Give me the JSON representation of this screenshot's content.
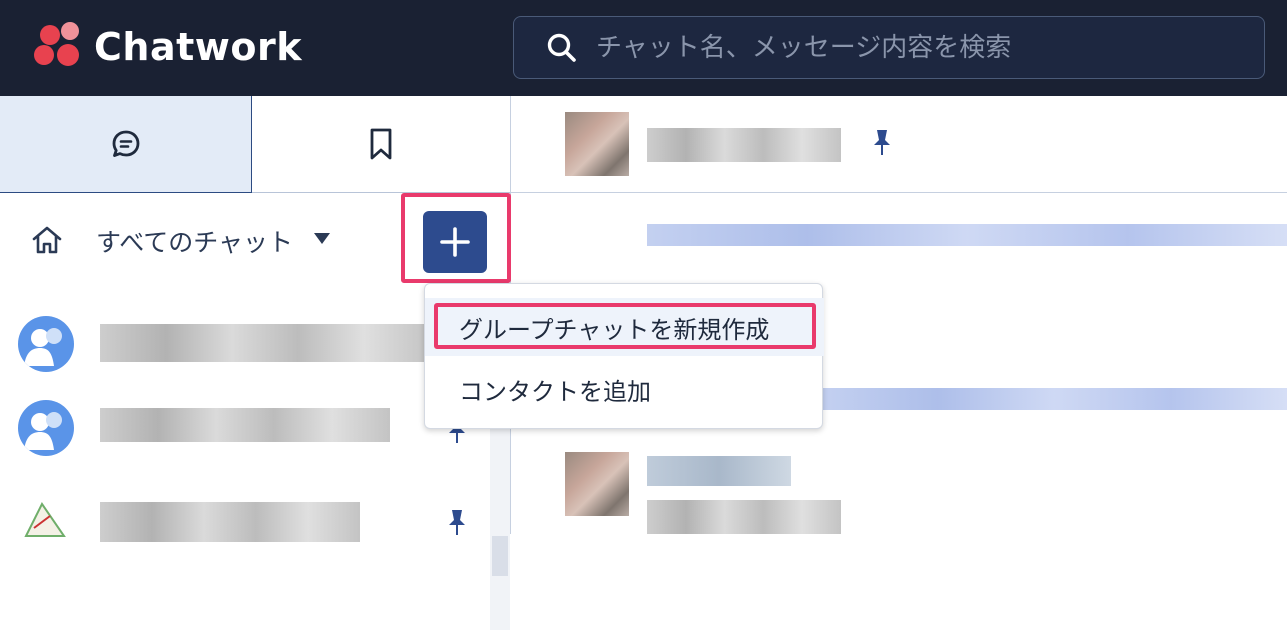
{
  "app": {
    "name": "Chatwork"
  },
  "search": {
    "placeholder": "チャット名、メッセージ内容を検索"
  },
  "sidebar": {
    "tabs": [
      {
        "name": "chat",
        "icon": "chat-bubble-icon",
        "active": true
      },
      {
        "name": "bookmark",
        "icon": "bookmark-icon",
        "active": false
      }
    ],
    "filter_label": "すべてのチャット"
  },
  "add_menu": {
    "items": [
      {
        "label": "グループチャットを新規作成",
        "highlighted": true
      },
      {
        "label": "コンタクトを追加",
        "highlighted": false
      }
    ]
  },
  "colors": {
    "header_bg": "#1a2133",
    "accent": "#2d4b8e",
    "highlight": "#e93a6c",
    "logo_red": "#e8424f"
  }
}
